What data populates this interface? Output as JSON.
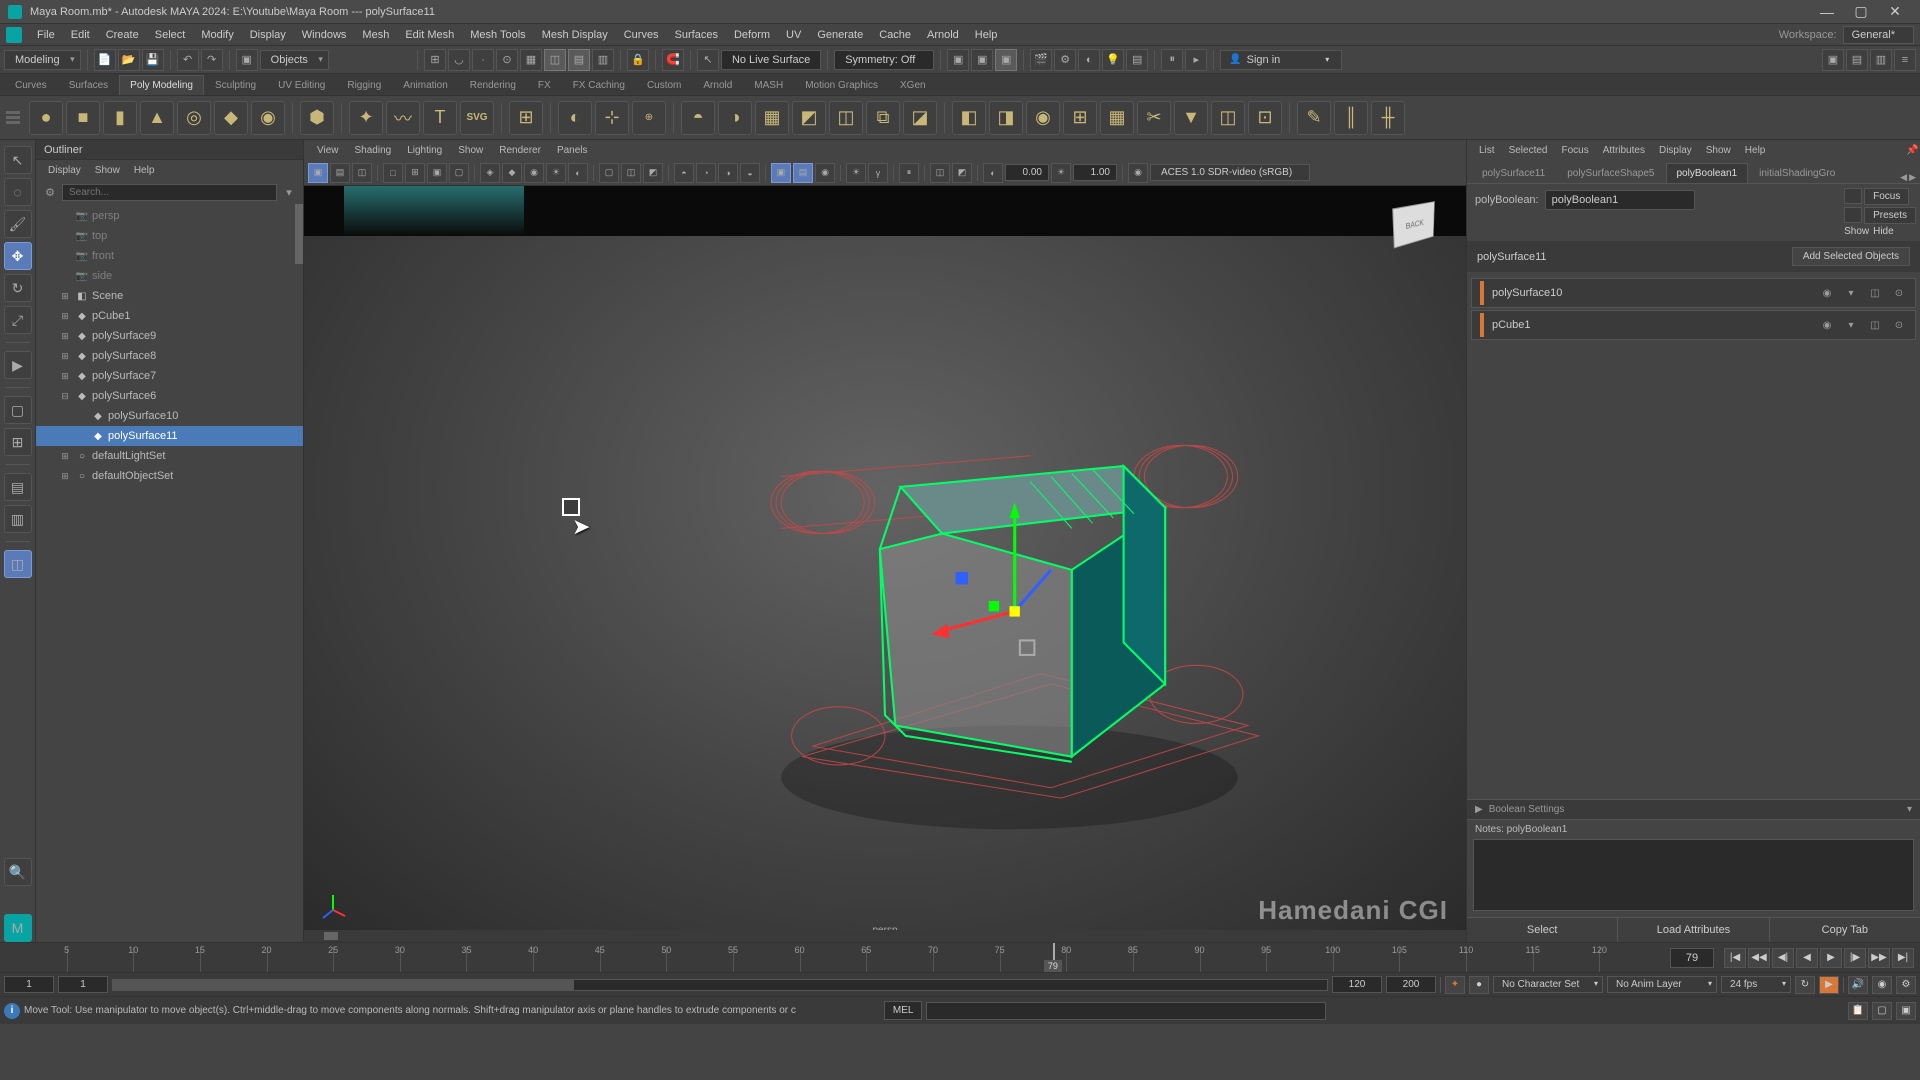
{
  "titlebar": {
    "text": "Maya Room.mb* - Autodesk MAYA 2024: E:\\Youtube\\Maya Room  ---  polySurface11"
  },
  "menubar": {
    "items": [
      "File",
      "Edit",
      "Create",
      "Select",
      "Modify",
      "Display",
      "Windows",
      "Mesh",
      "Edit Mesh",
      "Mesh Tools",
      "Mesh Display",
      "Curves",
      "Surfaces",
      "Deform",
      "UV",
      "Generate",
      "Cache",
      "Arnold",
      "Help"
    ],
    "workspace_label": "Workspace:",
    "workspace_value": "General*"
  },
  "toolbarRow": {
    "mode": "Modeling",
    "live_surface": "No Live Surface",
    "symmetry": "Symmetry: Off",
    "signin": "Sign in"
  },
  "shelfTabs": [
    "Curves",
    "Surfaces",
    "Poly Modeling",
    "Sculpting",
    "UV Editing",
    "Rigging",
    "Animation",
    "Rendering",
    "FX",
    "FX Caching",
    "Custom",
    "Arnold",
    "MASH",
    "Motion Graphics",
    "XGen"
  ],
  "shelfActiveTab": 2,
  "outliner": {
    "title": "Outliner",
    "menu": [
      "Display",
      "Show",
      "Help"
    ],
    "search_placeholder": "Search...",
    "items": [
      {
        "name": "persp",
        "icon": "📷",
        "indent": 1,
        "muted": true
      },
      {
        "name": "top",
        "icon": "📷",
        "indent": 1,
        "muted": true
      },
      {
        "name": "front",
        "icon": "📷",
        "indent": 1,
        "muted": true
      },
      {
        "name": "side",
        "icon": "📷",
        "indent": 1,
        "muted": true
      },
      {
        "name": "Scene",
        "icon": "◧",
        "indent": 1,
        "exp": "⊞"
      },
      {
        "name": "pCube1",
        "icon": "◆",
        "indent": 1,
        "exp": "⊞"
      },
      {
        "name": "polySurface9",
        "icon": "◆",
        "indent": 1,
        "exp": "⊞"
      },
      {
        "name": "polySurface8",
        "icon": "◆",
        "indent": 1,
        "exp": "⊞"
      },
      {
        "name": "polySurface7",
        "icon": "◆",
        "indent": 1,
        "exp": "⊞"
      },
      {
        "name": "polySurface6",
        "icon": "◆",
        "indent": 1,
        "exp": "⊟"
      },
      {
        "name": "polySurface10",
        "icon": "◆",
        "indent": 2
      },
      {
        "name": "polySurface11",
        "icon": "◆",
        "indent": 2,
        "selected": true
      },
      {
        "name": "defaultLightSet",
        "icon": "○",
        "indent": 1,
        "exp": "⊞"
      },
      {
        "name": "defaultObjectSet",
        "icon": "○",
        "indent": 1,
        "exp": "⊞"
      }
    ]
  },
  "viewport": {
    "menu": [
      "View",
      "Shading",
      "Lighting",
      "Show",
      "Renderer",
      "Panels"
    ],
    "opacity": "0.00",
    "exposure": "1.00",
    "color_space": "ACES 1.0 SDR-video (sRGB)",
    "viewcube_face": "BACK",
    "camera_label": "persp",
    "watermark": "Hamedani CGI"
  },
  "rightPanel": {
    "menu": [
      "List",
      "Selected",
      "Focus",
      "Attributes",
      "Display",
      "Show",
      "Help"
    ],
    "tabs": [
      "polySurface11",
      "polySurfaceShape5",
      "polyBoolean1",
      "initialShadingGro"
    ],
    "active_tab": 2,
    "node_label": "polyBoolean:",
    "node_value": "polyBoolean1",
    "buttons": {
      "focus": "Focus",
      "presets": "Presets",
      "show": "Show",
      "hide": "Hide"
    },
    "section_title": "polySurface11",
    "add_btn": "Add Selected Objects",
    "inputs": [
      {
        "name": "polySurface10"
      },
      {
        "name": "pCube1"
      }
    ],
    "collapsed_section": "Boolean Settings",
    "notes_label": "Notes: polyBoolean1",
    "bottom": {
      "select": "Select",
      "load": "Load Attributes",
      "copy": "Copy Tab"
    }
  },
  "timeline": {
    "ticks": [
      5,
      10,
      15,
      20,
      25,
      30,
      35,
      40,
      45,
      50,
      55,
      60,
      65,
      70,
      75,
      80,
      85,
      90,
      95,
      100,
      105,
      110,
      115,
      120
    ],
    "current_frame": "79",
    "frame_box": "79"
  },
  "rangeRow": {
    "start": "1",
    "range_start": "1",
    "range_end": "120",
    "end": "200",
    "char_set": "No Character Set",
    "anim_layer": "No Anim Layer",
    "fps": "24 fps"
  },
  "cmdRow": {
    "help": "Move Tool: Use manipulator to move object(s). Ctrl+middle-drag to move components along normals. Shift+drag manipulator axis or plane handles to extrude components or c",
    "lang": "MEL"
  }
}
